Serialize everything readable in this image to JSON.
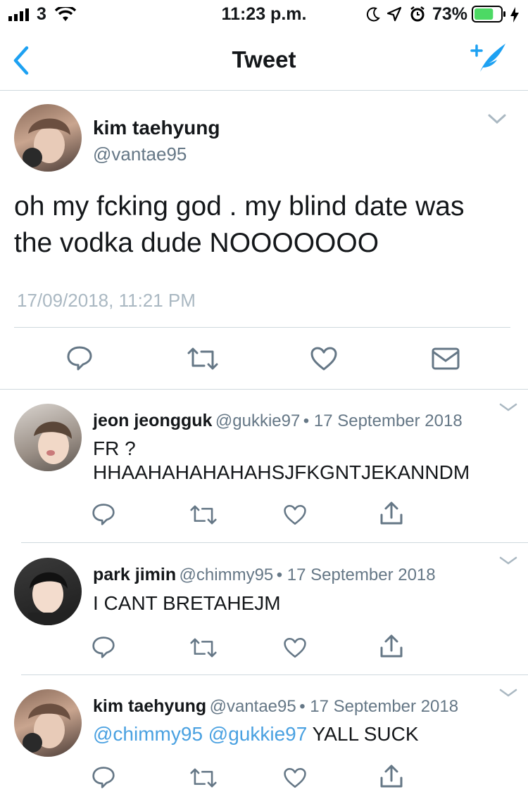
{
  "status_bar": {
    "carrier": "3",
    "time": "11:23 p.m.",
    "battery_percent": "73%",
    "battery_level": 0.73
  },
  "nav": {
    "title": "Tweet"
  },
  "main_tweet": {
    "name": "kim taehyung",
    "handle": "@vantae95",
    "text_line1": "oh my fcking god . my blind date was",
    "text_line2": "the vodka dude NOOOOOOO",
    "timestamp": "17/09/2018, 11:21 PM"
  },
  "replies": [
    {
      "name": "jeon jeongguk",
      "handle": "@gukkie97",
      "date": "• 17 September 2018",
      "line1": "FR ?",
      "line2": "HHAAHAHAHAHAHSJFKGNTJEKANNDM"
    },
    {
      "name": "park jimin",
      "handle": "@chimmy95",
      "date": "• 17 September 2018",
      "line1": "I CANT BRETAHEJM"
    },
    {
      "name": "kim taehyung",
      "handle": "@vantae95",
      "date": "• 17 September 2018",
      "mention1": "@chimmy95",
      "mention2": "@gukkie97",
      "text": "YALL SUCK"
    }
  ],
  "colors": {
    "link": "#4aa1e1",
    "icon_gray": "#657786",
    "divider": "#cfd9de",
    "battery_green": "#4cd964"
  }
}
